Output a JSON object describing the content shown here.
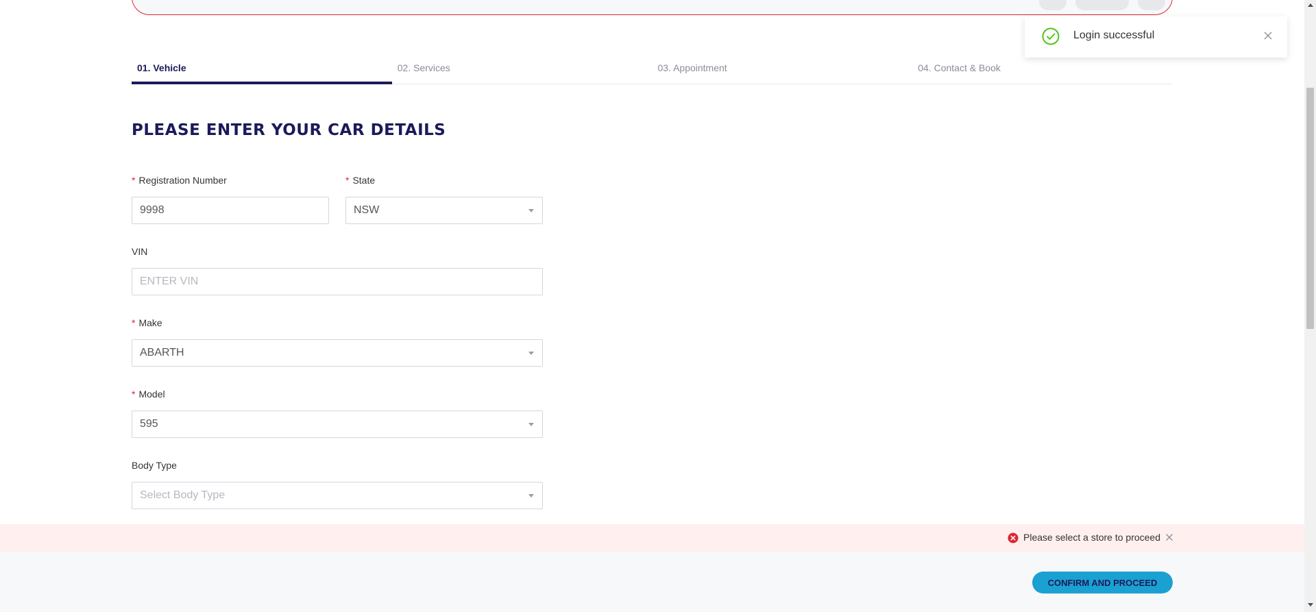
{
  "toast": {
    "message": "Login successful",
    "icon": "check-circle-icon",
    "icon_color": "#52c41a"
  },
  "tabs": [
    {
      "label": "01. Vehicle",
      "active": true
    },
    {
      "label": "02. Services",
      "active": false
    },
    {
      "label": "03. Appointment",
      "active": false
    },
    {
      "label": "04. Contact & Book",
      "active": false
    }
  ],
  "page_title": "PLEASE ENTER YOUR CAR DETAILS",
  "form": {
    "registration": {
      "label": "Registration Number",
      "required": true,
      "value": "9998"
    },
    "state": {
      "label": "State",
      "required": true,
      "value": "NSW"
    },
    "vin": {
      "label": "VIN",
      "required": false,
      "placeholder": "ENTER VIN"
    },
    "make": {
      "label": "Make",
      "required": true,
      "value": "ABARTH"
    },
    "model": {
      "label": "Model",
      "required": true,
      "value": "595"
    },
    "body_type": {
      "label": "Body Type",
      "required": false,
      "placeholder": "Select Body Type"
    }
  },
  "alert": {
    "message": "Please select a store to proceed",
    "icon": "error-circle-icon",
    "icon_color": "#e0242f"
  },
  "footer": {
    "confirm_label": "CONFIRM AND PROCEED"
  },
  "colors": {
    "brand_navy": "#1b1a5a",
    "accent_blue": "#1ba1d1",
    "required_red": "#e0242f"
  }
}
